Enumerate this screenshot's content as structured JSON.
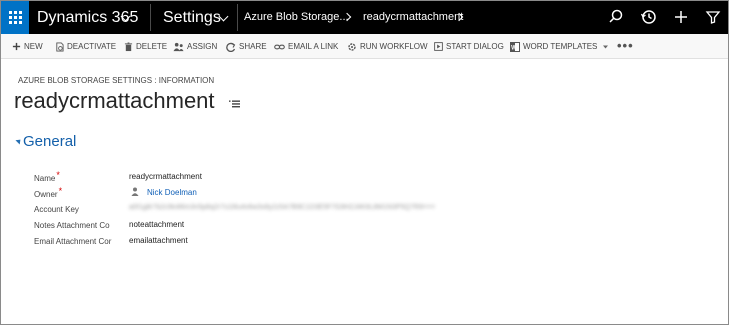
{
  "nav": {
    "app_name": "Dynamics 365",
    "area": "Settings",
    "breadcrumb": [
      "Azure Blob Storage...",
      "readycrmattachment"
    ]
  },
  "commands": [
    {
      "label": "NEW",
      "icon": "plus-icon"
    },
    {
      "label": "DEACTIVATE",
      "icon": "deactivate-icon"
    },
    {
      "label": "DELETE",
      "icon": "trash-icon"
    },
    {
      "label": "ASSIGN",
      "icon": "assign-icon"
    },
    {
      "label": "SHARE",
      "icon": "share-icon"
    },
    {
      "label": "EMAIL A LINK",
      "icon": "link-icon"
    },
    {
      "label": "RUN WORKFLOW",
      "icon": "workflow-icon"
    },
    {
      "label": "START DIALOG",
      "icon": "dialog-icon"
    },
    {
      "label": "WORD TEMPLATES",
      "icon": "word-icon"
    }
  ],
  "more_label": "•••",
  "record": {
    "entity_label": "AZURE BLOB STORAGE SETTINGS : INFORMATION",
    "title": "readycrmattachment"
  },
  "section": {
    "title": "General",
    "fields": [
      {
        "label": "Name",
        "required": "*",
        "value": "readycrmattachment"
      },
      {
        "label": "Owner",
        "required": "*",
        "value": "Nick Doelman"
      },
      {
        "label": "Account Key",
        "value": "a0f1g8r7b2c9k4l6m3n5p8q2r7s1t9u4v6w3x8y2z5A7B9C1D3E5F7G9H2J4K6L8M1N3P5Q7R9==="
      },
      {
        "label": "Notes Attachment Co",
        "value": "noteattachment"
      },
      {
        "label": "Email Attachment Cor",
        "value": "emailattachment"
      }
    ]
  },
  "colors": {
    "nav_bg": "#000000",
    "waffle_bg": "#0072c6",
    "accent": "#1460aa",
    "required": "#d40000"
  }
}
